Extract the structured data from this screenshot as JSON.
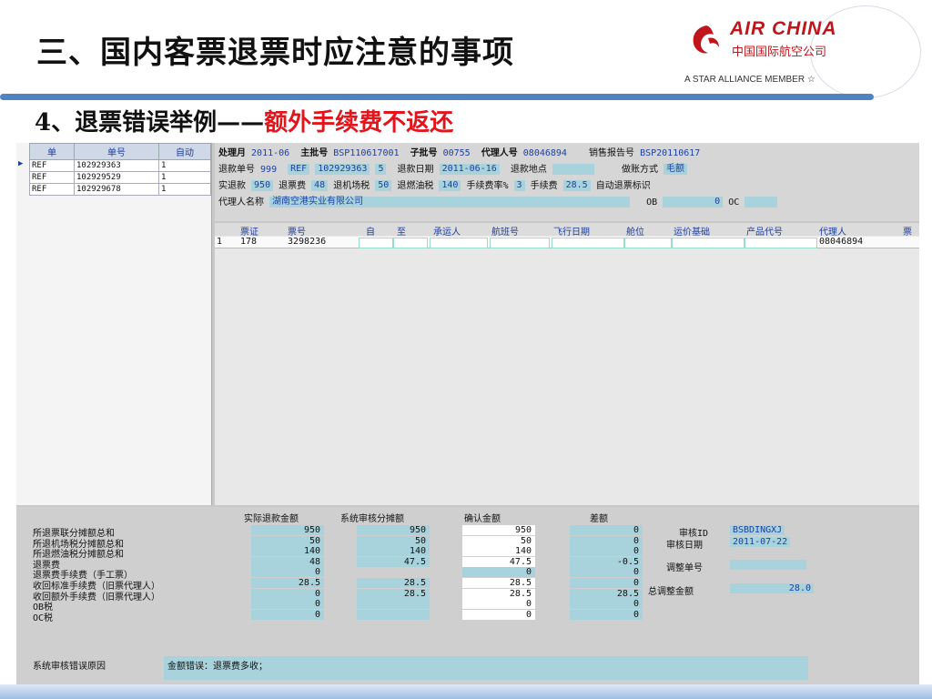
{
  "slide": {
    "title": "三、国内客票退票时应注意的事项",
    "subtitle_prefix": "4、退票错误举例——",
    "subtitle_highlight": "额外手续费不返还"
  },
  "logo": {
    "brand": "AIR CHINA",
    "brand_cn": "中国国际航空公司",
    "alliance": "A STAR ALLIANCE MEMBER ☆"
  },
  "refund_list": {
    "headers": [
      "单",
      "单号",
      "自动"
    ],
    "rows": [
      {
        "type": "REF",
        "number": "102929363",
        "auto": "1"
      },
      {
        "type": "REF",
        "number": "102929529",
        "auto": "1"
      },
      {
        "type": "REF",
        "number": "102929678",
        "auto": "1"
      }
    ]
  },
  "header_info": {
    "process_month_label": "处理月",
    "process_month": "2011-06",
    "main_batch_label": "主批号",
    "main_batch": "BSP110617001",
    "sub_batch_label": "子批号",
    "sub_batch": "00755",
    "agent_no_label": "代理人号",
    "agent_no": "08046894",
    "sales_report_label": "销售报告号",
    "sales_report": "BSP20110617",
    "refund_no_label": "退款单号",
    "refund_no": "999",
    "ref_label": "REF",
    "ref_number": "102929363",
    "ref_count": "5",
    "refund_date_label": "退款日期",
    "refund_date": "2011-06-16",
    "refund_place_label": "退款地点",
    "refund_place": "",
    "account_method_label": "做账方式",
    "account_method": "毛额",
    "actual_refund_label": "实退款",
    "actual_refund": "950",
    "refund_fee_label": "退票费",
    "refund_fee": "48",
    "airport_tax_label": "退机场税",
    "airport_tax": "50",
    "fuel_tax_label": "退燃油税",
    "fuel_tax": "140",
    "fee_rate_label": "手续费率%",
    "fee_rate": "3",
    "fee_label": "手续费",
    "fee": "28.5",
    "auto_refund_label": "自动退票标识",
    "agent_name_label": "代理人名称",
    "agent_name": "湖南空港实业有限公司",
    "ob_label": "OB",
    "ob_value": "0",
    "oc_label": "OC"
  },
  "ticket_grid": {
    "headers": [
      "票证",
      "票号",
      "自",
      "至",
      "承运人",
      "航班号",
      "飞行日期",
      "舱位",
      "运价基础",
      "产品代号",
      "代理人",
      "票"
    ],
    "row": {
      "index": "1",
      "coupon": "178",
      "ticket": "3298236",
      "agent": "08046894"
    }
  },
  "summary": {
    "col_headers": [
      "实际退款金额",
      "系统审核分摊额",
      "确认金额",
      "差额"
    ],
    "rows": [
      {
        "label": "所退票联分摊额总和",
        "actual": "950",
        "system": "950",
        "confirm": "950",
        "diff": "0"
      },
      {
        "label": "所退机场税分摊额总和",
        "actual": "50",
        "system": "50",
        "confirm": "50",
        "diff": "0"
      },
      {
        "label": "所退燃油税分摊额总和",
        "actual": "140",
        "system": "140",
        "confirm": "140",
        "diff": "0"
      },
      {
        "label": "退票费",
        "actual": "48",
        "system": "47.5",
        "confirm": "47.5",
        "diff": "-0.5"
      },
      {
        "label": "退票费手续费（手工票）",
        "actual": "0",
        "system": "",
        "confirm": "0",
        "diff": "0"
      },
      {
        "label": "收回标准手续费（旧票代理人）",
        "actual": "28.5",
        "system": "28.5",
        "confirm": "28.5",
        "diff": "0"
      },
      {
        "label": "收回额外手续费（旧票代理人）",
        "actual": "0",
        "system": "28.5",
        "confirm": "28.5",
        "diff": "28.5"
      },
      {
        "label": "OB税",
        "actual": "0",
        "system": "",
        "confirm": "0",
        "diff": "0"
      },
      {
        "label": "OC税",
        "actual": "0",
        "system": "",
        "confirm": "0",
        "diff": "0"
      }
    ],
    "audit_id_label": "审核ID",
    "audit_id": "BSBDINGXJ",
    "audit_date_label": "审核日期",
    "audit_date": "2011-07-22",
    "adjust_no_label": "调整单号",
    "adjust_no": "",
    "total_adjust_label": "总调整金额",
    "total_adjust": "28.0",
    "error_label": "系统审核错误原因",
    "error_text": "金额错误：退票费多收；"
  }
}
